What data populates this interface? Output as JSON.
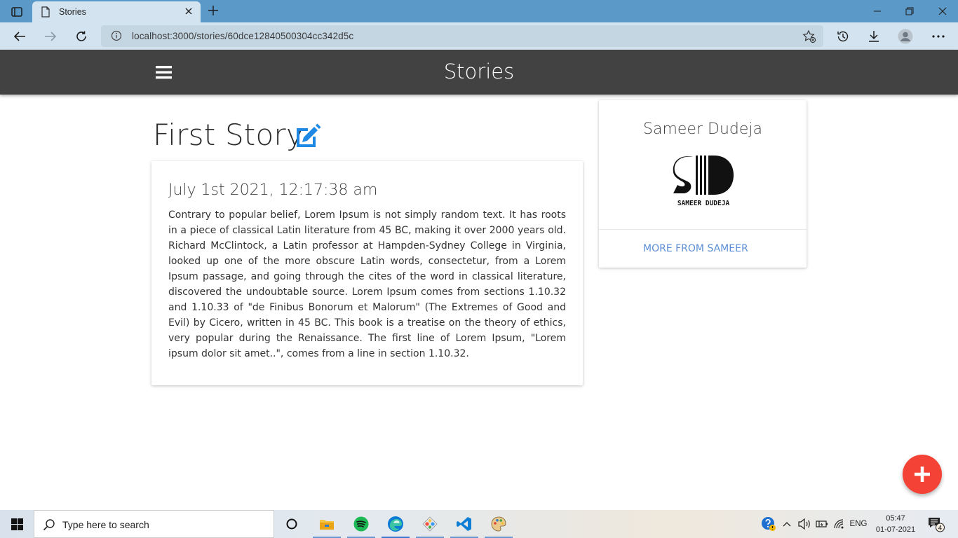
{
  "browser": {
    "tab_title": "Stories",
    "url": "localhost:3000/stories/60dce12840500304cc342d5c"
  },
  "app": {
    "brand": "Stories",
    "menu_icon": "hamburger-icon"
  },
  "story": {
    "title": "First Story",
    "date": "July 1st 2021, 12:17:38 am",
    "body": "Contrary to popular belief, Lorem Ipsum is not simply random text. It has roots in a piece of classical Latin literature from 45 BC, making it over 2000 years old. Richard McClintock, a Latin professor at Hampden-Sydney College in Virginia, looked up one of the more obscure Latin words, consectetur, from a Lorem Ipsum passage, and going through the cites of the word in classical literature, discovered the undoubtable source. Lorem Ipsum comes from sections 1.10.32 and 1.10.33 of \"de Finibus Bonorum et Malorum\" (The Extremes of Good and Evil) by Cicero, written in 45 BC. This book is a treatise on the theory of ethics, very popular during the Renaissance. The first line of Lorem Ipsum, \"Lorem ipsum dolor sit amet..\", comes from a line in section 1.10.32."
  },
  "author": {
    "name": "Sameer Dudeja",
    "logo_caption": "SAMEER DUDEJA",
    "more_link": "MORE FROM SAMEER"
  },
  "taskbar": {
    "search_placeholder": "Type here to search",
    "language": "ENG",
    "time": "05:47",
    "date": "01-07-2021",
    "notification_count": "4"
  },
  "colors": {
    "app_bar": "#424242",
    "accent_blue": "#1e88e5",
    "fab": "#f44336",
    "link": "#5c8fd6"
  }
}
